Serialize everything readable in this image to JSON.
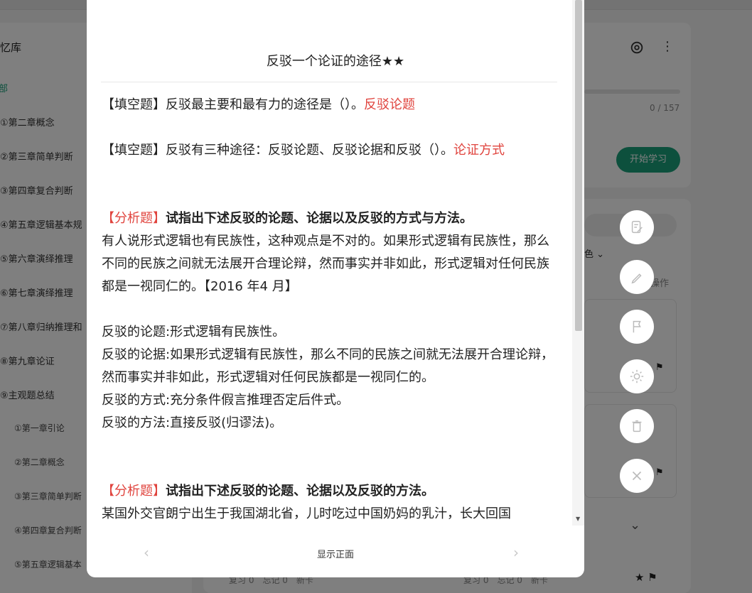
{
  "sidebar": {
    "title": "忆库",
    "all_label": "部",
    "items": [
      {
        "label": "①第二章概念"
      },
      {
        "label": "②第三章简单判断"
      },
      {
        "label": "③第四章复合判断"
      },
      {
        "label": "④第五章逻辑基本规"
      },
      {
        "label": "⑤第六章演绎推理"
      },
      {
        "label": "⑥第七章演绎推理"
      },
      {
        "label": "⑦第八章归纳推理和"
      },
      {
        "label": "⑧第九章论证"
      },
      {
        "label": "⑨主观题总结"
      }
    ],
    "sub_items": [
      {
        "label": "①第一章引论"
      },
      {
        "label": "②第二章概念"
      },
      {
        "label": "③第三章简单判断"
      },
      {
        "label": "④第四章复合判断"
      },
      {
        "label": "⑤第五章逻辑基本"
      }
    ]
  },
  "background": {
    "progress_text": "0 / 157",
    "start_button": "开始学习",
    "color_filter": "色",
    "ops_text": "操作",
    "stats_left": "复习 0　忘记 0　新卡",
    "stats_right": "复习 0　忘记 0　新卡",
    "accent_color": "#1aa07a"
  },
  "modal": {
    "title": "反驳一个论证的途径★★",
    "q1_prefix": "【填空题】反驳最主要和最有力的途径是（）。",
    "q1_answer": "反驳论题",
    "q2_prefix": "【填空题】反驳有三种途径：反驳论题、反驳论据和反驳（）。",
    "q2_answer": "论证方式",
    "analysis_tag": "【分析题】",
    "a1_heading": "试指出下述反驳的论题、论据以及反驳的方式与方法。",
    "a1_body": "有人说形式逻辑也有民族性，这种观点是不对的。如果形式逻辑有民族性，那么不同的民族之间就无法展开合理论辩，然而事实并非如此，形式逻辑对任何民族都是一视同仁的。【2016 年4 月】",
    "a1_line1": "反驳的论题:形式逻辑有民族性。",
    "a1_line2": "反驳的论据:如果形式逻辑有民族性，那么不同的民族之间就无法展开合理论辩，然而事实并非如此，形式逻辑对任何民族都是一视同仁的。",
    "a1_line3": "反驳的方式:充分条件假言推理否定后件式。",
    "a1_line4": "反驳的方法:直接反驳(归谬法)。",
    "a2_heading": "试指出下述反驳的论题、论据以及反驳的方法。",
    "a2_body": "某国外交官朗宁出生于我国湖北省，儿时吃过中国奶妈的乳汁，长大回国",
    "footer_label": "显示正面",
    "answer_color": "#e0443e"
  }
}
